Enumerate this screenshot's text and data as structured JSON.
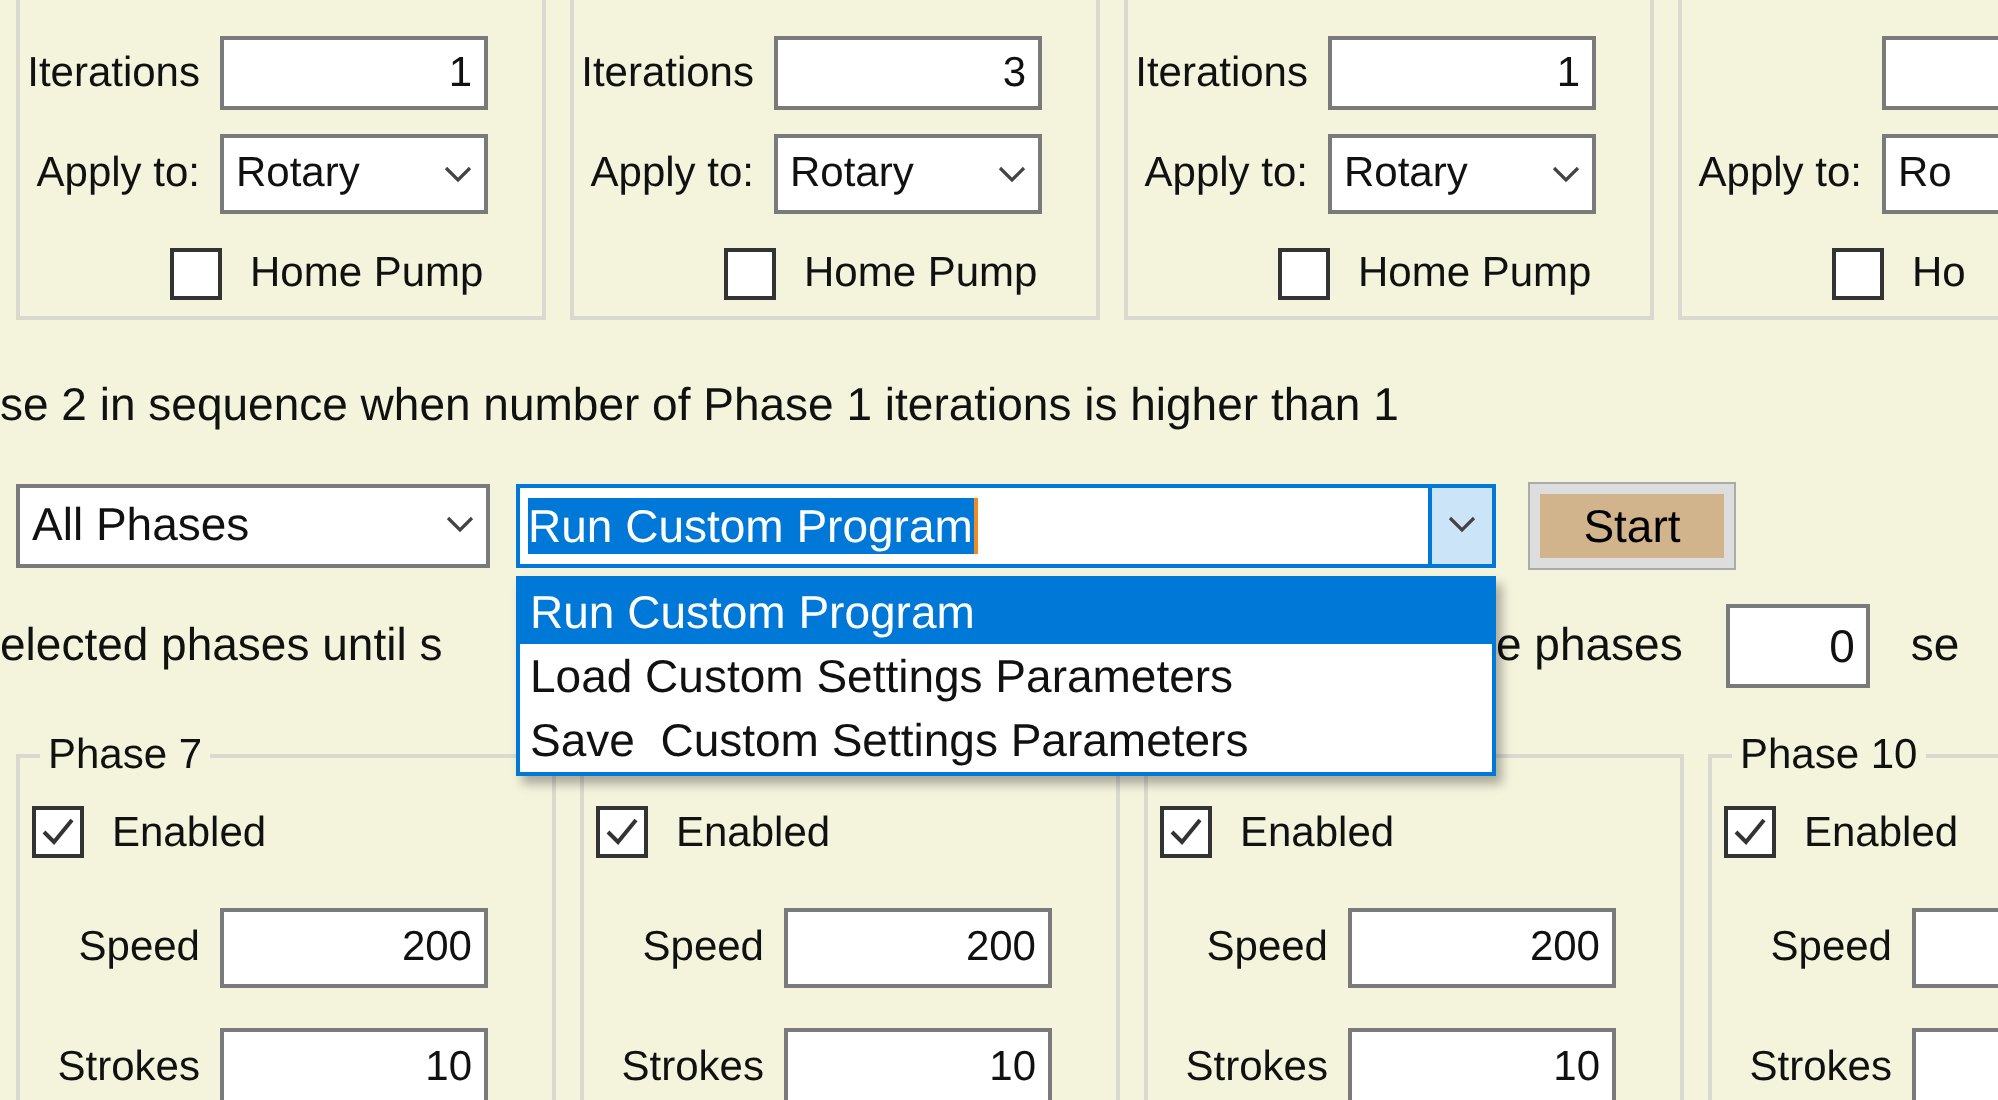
{
  "top_groups": [
    {
      "iterations_label": "Iterations",
      "iterations": "1",
      "apply_label": "Apply to:",
      "apply_value": "Rotary",
      "home_pump_label": "Home Pump",
      "home_pump_checked": false
    },
    {
      "iterations_label": "Iterations",
      "iterations": "3",
      "apply_label": "Apply to:",
      "apply_value": "Rotary",
      "home_pump_label": "Home Pump",
      "home_pump_checked": false
    },
    {
      "iterations_label": "Iterations",
      "iterations": "1",
      "apply_label": "Apply to:",
      "apply_value": "Rotary",
      "home_pump_label": "Home Pump",
      "home_pump_checked": false
    },
    {
      "apply_label": "Apply to:",
      "apply_value": "Ro",
      "home_pump_label": "Ho",
      "home_pump_checked": false
    }
  ],
  "sequence_note": "se 2 in sequence when number of Phase 1 iterations is higher than 1",
  "phase_select": {
    "value": "All Phases"
  },
  "action_combo": {
    "value": "Run Custom Program",
    "text_selected": true,
    "expanded": true,
    "options": [
      {
        "label": "Run Custom Program",
        "selected": true
      },
      {
        "label": "Load Custom Settings Parameters",
        "selected": false
      },
      {
        "label": "Save  Custom Settings Parameters",
        "selected": false
      }
    ]
  },
  "start_button": "Start",
  "repeat_row": {
    "text_left": "elected phases until s",
    "text_right": "e phases",
    "delay": "0",
    "unit": "se"
  },
  "phase_groups": [
    {
      "title": "Phase 7",
      "enabled_label": "Enabled",
      "enabled": true,
      "speed_label": "Speed",
      "speed": "200",
      "strokes_label": "Strokes",
      "strokes": "10"
    },
    {
      "enabled_label": "Enabled",
      "enabled": true,
      "speed_label": "Speed",
      "speed": "200",
      "strokes_label": "Strokes",
      "strokes": "10"
    },
    {
      "enabled_label": "Enabled",
      "enabled": true,
      "speed_label": "Speed",
      "speed": "200",
      "strokes_label": "Strokes",
      "strokes": "10"
    },
    {
      "title": "Phase 10",
      "enabled_label": "Enabled",
      "enabled": true,
      "speed_label": "Speed",
      "strokes_label": "Strokes"
    }
  ]
}
